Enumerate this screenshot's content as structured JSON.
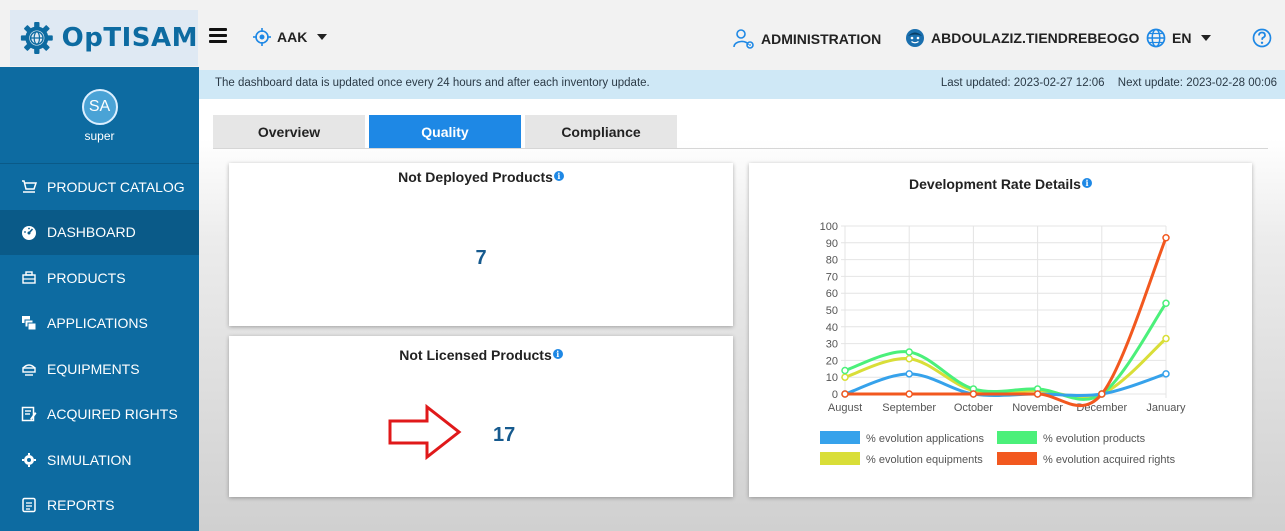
{
  "brand": {
    "name": "OpTISAM"
  },
  "header": {
    "entity": "AAK",
    "administration_label": "ADMINISTRATION",
    "user": "ABDOULAZIZ.TIENDREBEOGO",
    "language": "EN",
    "help_icon": "help-circle-icon"
  },
  "sidebar": {
    "profile": {
      "initials": "SA",
      "name": "super"
    },
    "items": [
      {
        "label": "PRODUCT CATALOG",
        "icon": "cart-icon"
      },
      {
        "label": "DASHBOARD",
        "icon": "dashboard-gauge-icon"
      },
      {
        "label": "PRODUCTS",
        "icon": "products-icon"
      },
      {
        "label": "APPLICATIONS",
        "icon": "applications-icon"
      },
      {
        "label": "EQUIPMENTS",
        "icon": "equipments-icon"
      },
      {
        "label": "ACQUIRED RIGHTS",
        "icon": "acquired-rights-icon"
      },
      {
        "label": "SIMULATION",
        "icon": "simulation-icon"
      },
      {
        "label": "REPORTS",
        "icon": "reports-icon"
      }
    ],
    "active_index": 1
  },
  "infobar": {
    "notice": "The dashboard data is updated once every 24 hours and after each inventory update.",
    "last_updated": "Last updated: 2023-02-27 12:06",
    "next_update": "Next update: 2023-02-28 00:06"
  },
  "tabs": [
    {
      "label": "Overview"
    },
    {
      "label": "Quality"
    },
    {
      "label": "Compliance"
    }
  ],
  "active_tab": 1,
  "cards": {
    "not_deployed": {
      "title": "Not Deployed Products",
      "value": "7"
    },
    "not_licensed": {
      "title": "Not Licensed Products",
      "value": "17"
    },
    "development": {
      "title": "Development Rate Details"
    }
  },
  "colors": {
    "brand_blue": "#0d6ba1",
    "accent_blue": "#1e88e5",
    "value_blue": "#165a8e",
    "arrow_red": "#e0191a"
  },
  "chart_data": {
    "type": "line",
    "title": "Development Rate Details",
    "categories": [
      "August",
      "September",
      "October",
      "November",
      "December",
      "January"
    ],
    "ylim": [
      0,
      100
    ],
    "yticks": [
      0,
      10,
      20,
      30,
      40,
      50,
      60,
      70,
      80,
      90,
      100
    ],
    "grid": true,
    "legend_position": "bottom",
    "series": [
      {
        "name": "% evolution applications",
        "color": "#36a2eb",
        "values": [
          0,
          12,
          0,
          0,
          0,
          12
        ]
      },
      {
        "name": "% evolution products",
        "color": "#4bf07a",
        "values": [
          14,
          25,
          3,
          3,
          0,
          54
        ]
      },
      {
        "name": "% evolution equipments",
        "color": "#d9de38",
        "values": [
          10,
          21,
          2,
          2,
          0,
          33
        ]
      },
      {
        "name": "% evolution acquired rights",
        "color": "#f2581f",
        "values": [
          0,
          0,
          0,
          0,
          0,
          93
        ]
      }
    ]
  }
}
